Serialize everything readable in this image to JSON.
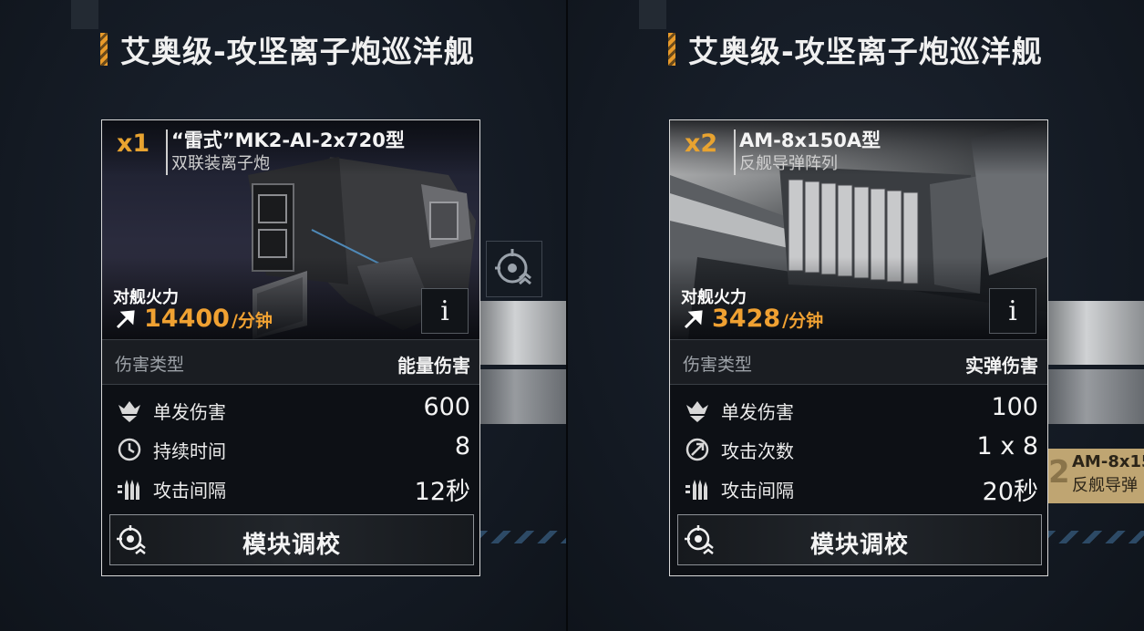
{
  "panels": [
    {
      "ship_title": "艾奥级-攻坚离子炮巡洋舰",
      "count": "x1",
      "weapon_name": "“雷式”MK2-AI-2x720型",
      "weapon_type": "双联装离子炮",
      "firepower_label": "对舰火力",
      "firepower_value": "14400",
      "firepower_unit": "/分钟",
      "info_label": "i",
      "damage_type_label": "伤害类型",
      "damage_type_value": "能量伤害",
      "stats": [
        {
          "icon": "single-damage-icon",
          "label": "单发伤害",
          "value": "600"
        },
        {
          "icon": "clock-icon",
          "label": "持续时间",
          "value": "8"
        },
        {
          "icon": "attack-interval-icon",
          "label": "攻击间隔",
          "value": "12秒"
        }
      ],
      "tune_button": "模块调校"
    },
    {
      "ship_title": "艾奥级-攻坚离子炮巡洋舰",
      "count": "x2",
      "weapon_name": "AM-8x150A型",
      "weapon_type": "反舰导弹阵列",
      "firepower_label": "对舰火力",
      "firepower_value": "3428",
      "firepower_unit": "/分钟",
      "info_label": "i",
      "damage_type_label": "伤害类型",
      "damage_type_value": "实弹伤害",
      "stats": [
        {
          "icon": "single-damage-icon",
          "label": "单发伤害",
          "value": "100"
        },
        {
          "icon": "attack-count-icon",
          "label": "攻击次数",
          "value": "1 x 8"
        },
        {
          "icon": "attack-interval-icon",
          "label": "攻击间隔",
          "value": "20秒"
        }
      ],
      "tune_button": "模块调校"
    }
  ],
  "side_peek": {
    "number": "2",
    "name": "AM-8x15",
    "type": "反舰导弹"
  },
  "colors": {
    "accent_orange": "#f0a132",
    "count_orange": "#e8a330",
    "background": "#151b24",
    "card_border": "#d9d9d9"
  }
}
